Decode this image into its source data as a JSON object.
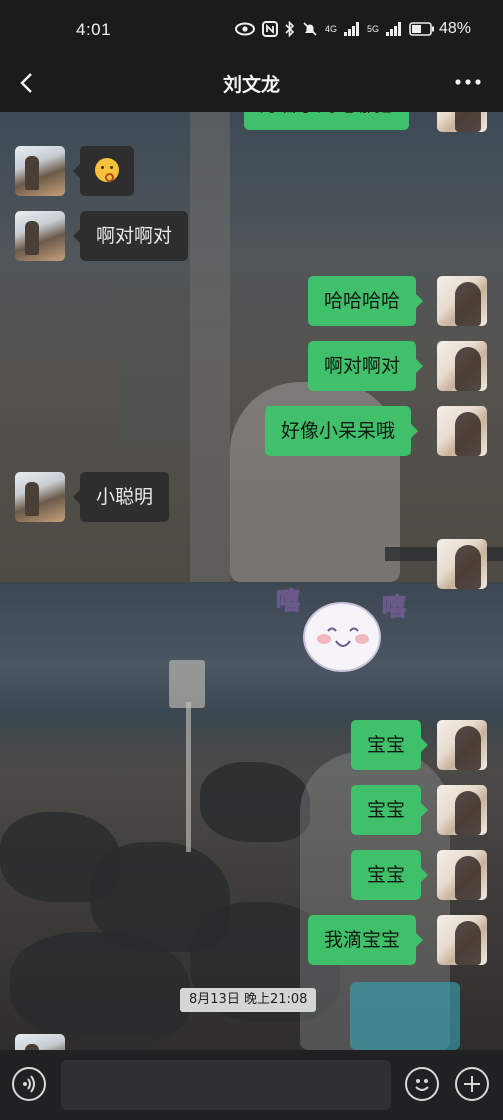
{
  "status_bar": {
    "time": "4:01",
    "network_1": "4G",
    "network_2": "5G",
    "battery": "48%"
  },
  "header": {
    "title": "刘文龙",
    "back_icon": "chevron-left-icon",
    "more_icon": "more-dots-icon"
  },
  "messages": [
    {
      "side": "right",
      "text": "好看小刘跑哪把",
      "partial": true
    },
    {
      "side": "left",
      "text": "",
      "emoji": "kiss-face-emoji"
    },
    {
      "side": "left",
      "text": "啊对啊对"
    },
    {
      "side": "right",
      "text": "哈哈哈哈"
    },
    {
      "side": "right",
      "text": "啊对啊对"
    },
    {
      "side": "right",
      "text": "好像小呆呆哦"
    },
    {
      "side": "left",
      "text": "小聪明"
    },
    {
      "side": "right",
      "text": "",
      "sticker": "xixi-ghost-sticker",
      "sticker_text_left": "嘻",
      "sticker_text_right": "嘻"
    },
    {
      "side": "right",
      "text": "宝宝"
    },
    {
      "side": "right",
      "text": "宝宝"
    },
    {
      "side": "right",
      "text": "宝宝"
    },
    {
      "side": "right",
      "text": "我滴宝宝"
    }
  ],
  "timestamp": "8月13日 晚上21:08",
  "input_bar": {
    "voice_icon": "voice-icon",
    "input_placeholder": "",
    "emoji_icon": "emoji-icon",
    "plus_icon": "plus-icon"
  },
  "colors": {
    "my_bubble": "#40c06a",
    "friend_bubble": "#2e2e2e",
    "bar_background": "#1b1b1b"
  }
}
